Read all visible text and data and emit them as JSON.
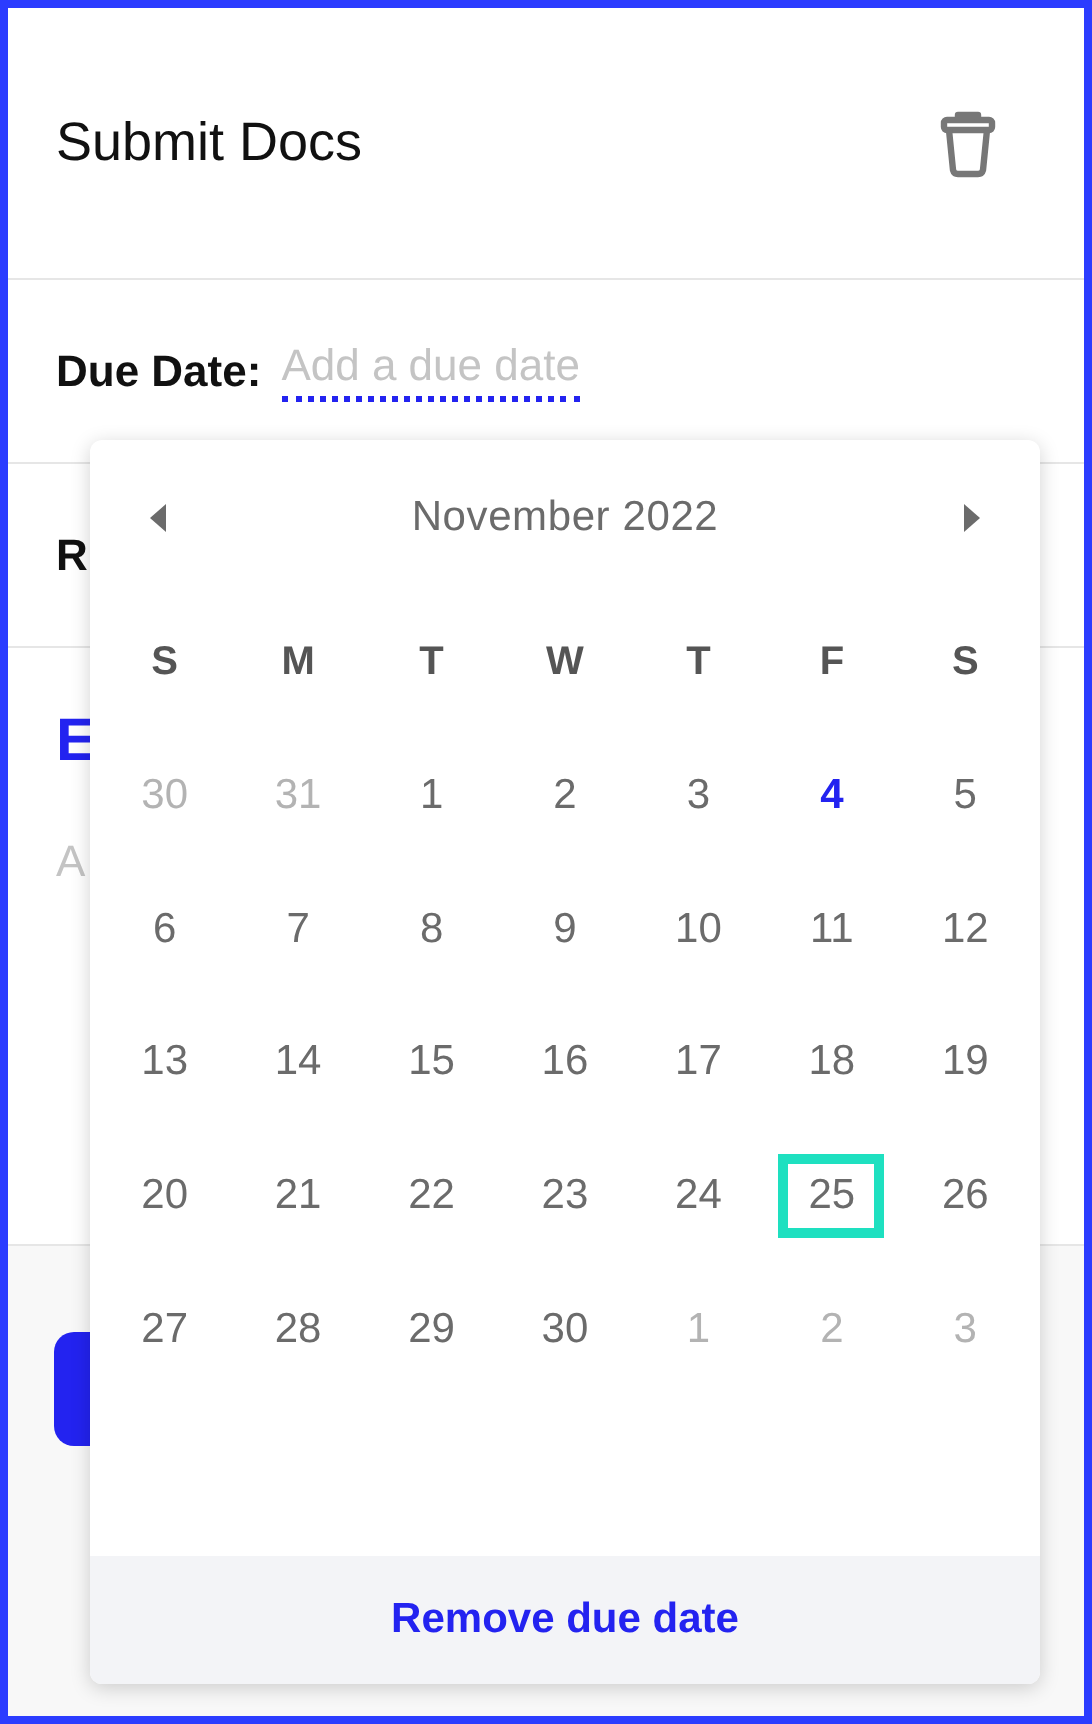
{
  "title": "Submit Docs",
  "due_date": {
    "label": "Due Date:",
    "placeholder": "Add a due date"
  },
  "partial_rows": [
    {
      "kind": "label",
      "text": "R"
    },
    {
      "kind": "heading",
      "text": "E"
    },
    {
      "kind": "hint",
      "text": "A"
    }
  ],
  "calendar": {
    "month": "November 2022",
    "weekdays": [
      "S",
      "M",
      "T",
      "W",
      "T",
      "F",
      "S"
    ],
    "days": [
      {
        "label": "30",
        "in_month": false,
        "today": false,
        "selected": false
      },
      {
        "label": "31",
        "in_month": false,
        "today": false,
        "selected": false
      },
      {
        "label": "1",
        "in_month": true,
        "today": false,
        "selected": false
      },
      {
        "label": "2",
        "in_month": true,
        "today": false,
        "selected": false
      },
      {
        "label": "3",
        "in_month": true,
        "today": false,
        "selected": false
      },
      {
        "label": "4",
        "in_month": true,
        "today": true,
        "selected": false
      },
      {
        "label": "5",
        "in_month": true,
        "today": false,
        "selected": false
      },
      {
        "label": "6",
        "in_month": true,
        "today": false,
        "selected": false
      },
      {
        "label": "7",
        "in_month": true,
        "today": false,
        "selected": false
      },
      {
        "label": "8",
        "in_month": true,
        "today": false,
        "selected": false
      },
      {
        "label": "9",
        "in_month": true,
        "today": false,
        "selected": false
      },
      {
        "label": "10",
        "in_month": true,
        "today": false,
        "selected": false
      },
      {
        "label": "11",
        "in_month": true,
        "today": false,
        "selected": false
      },
      {
        "label": "12",
        "in_month": true,
        "today": false,
        "selected": false
      },
      {
        "label": "13",
        "in_month": true,
        "today": false,
        "selected": false
      },
      {
        "label": "14",
        "in_month": true,
        "today": false,
        "selected": false
      },
      {
        "label": "15",
        "in_month": true,
        "today": false,
        "selected": false
      },
      {
        "label": "16",
        "in_month": true,
        "today": false,
        "selected": false
      },
      {
        "label": "17",
        "in_month": true,
        "today": false,
        "selected": false
      },
      {
        "label": "18",
        "in_month": true,
        "today": false,
        "selected": false
      },
      {
        "label": "19",
        "in_month": true,
        "today": false,
        "selected": false
      },
      {
        "label": "20",
        "in_month": true,
        "today": false,
        "selected": false
      },
      {
        "label": "21",
        "in_month": true,
        "today": false,
        "selected": false
      },
      {
        "label": "22",
        "in_month": true,
        "today": false,
        "selected": false
      },
      {
        "label": "23",
        "in_month": true,
        "today": false,
        "selected": false
      },
      {
        "label": "24",
        "in_month": true,
        "today": false,
        "selected": false
      },
      {
        "label": "25",
        "in_month": true,
        "today": false,
        "selected": true
      },
      {
        "label": "26",
        "in_month": true,
        "today": false,
        "selected": false
      },
      {
        "label": "27",
        "in_month": true,
        "today": false,
        "selected": false
      },
      {
        "label": "28",
        "in_month": true,
        "today": false,
        "selected": false
      },
      {
        "label": "29",
        "in_month": true,
        "today": false,
        "selected": false
      },
      {
        "label": "30",
        "in_month": true,
        "today": false,
        "selected": false
      },
      {
        "label": "1",
        "in_month": false,
        "today": false,
        "selected": false
      },
      {
        "label": "2",
        "in_month": false,
        "today": false,
        "selected": false
      },
      {
        "label": "3",
        "in_month": false,
        "today": false,
        "selected": false
      }
    ],
    "remove": "Remove due date"
  }
}
